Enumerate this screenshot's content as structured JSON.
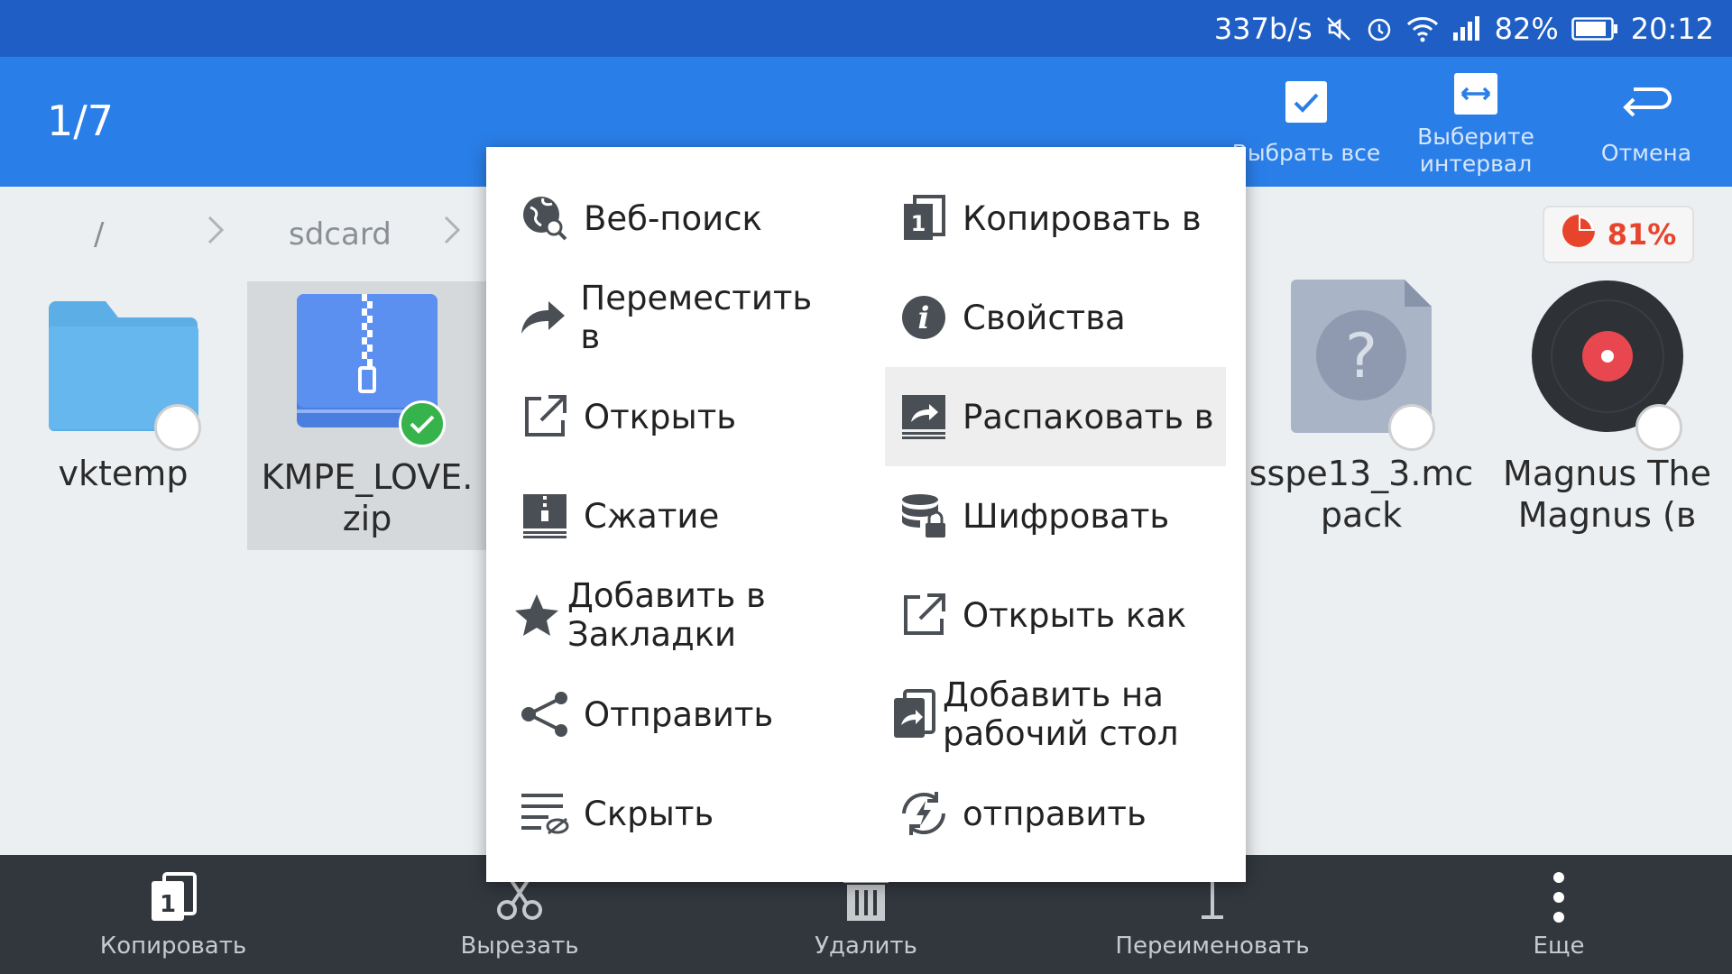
{
  "status_bar": {
    "speed": "337b/s",
    "battery": "82%",
    "time": "20:12"
  },
  "app_bar": {
    "counter": "1/7",
    "actions": [
      {
        "label": "Выбрать все",
        "icon": "select-all-icon"
      },
      {
        "label": "Выберите интервал",
        "icon": "select-range-icon"
      },
      {
        "label": "Отмена",
        "icon": "undo-icon"
      }
    ]
  },
  "breadcrumb": {
    "root": "/",
    "folder": "sdcard"
  },
  "storage": {
    "percent": "81%",
    "color": "#e8442c"
  },
  "files": [
    {
      "name": "vktemp",
      "type": "folder",
      "selected": false
    },
    {
      "name": "KMPE_LOVE.\nzip",
      "type": "zip",
      "selected": true
    },
    {
      "name": "sspe13_3.mc\npack",
      "type": "unknown",
      "selected": false
    },
    {
      "name": "Magnus The\nMagnus (в",
      "type": "audio",
      "selected": false
    }
  ],
  "menu": {
    "left": [
      {
        "label": "Веб-поиск",
        "icon": "web-search-icon"
      },
      {
        "label": "Переместить в",
        "icon": "move-arrow-icon"
      },
      {
        "label": "Открыть",
        "icon": "open-external-icon"
      },
      {
        "label": "Сжатие",
        "icon": "compress-icon"
      },
      {
        "label": "Добавить в Закладки",
        "icon": "star-icon"
      },
      {
        "label": "Отправить",
        "icon": "share-icon"
      },
      {
        "label": "Скрыть",
        "icon": "hide-icon"
      }
    ],
    "right": [
      {
        "label": "Копировать в",
        "icon": "copy-to-icon"
      },
      {
        "label": "Свойства",
        "icon": "info-icon"
      },
      {
        "label": "Распаковать в",
        "icon": "extract-icon",
        "highlighted": true
      },
      {
        "label": "Шифровать",
        "icon": "encrypt-icon"
      },
      {
        "label": "Открыть как",
        "icon": "open-as-icon"
      },
      {
        "label": "Добавить на рабочий стол",
        "icon": "add-desktop-icon"
      },
      {
        "label": "отправить",
        "icon": "send-flash-icon"
      }
    ]
  },
  "bottom_bar": [
    {
      "label": "Копировать",
      "icon": "copy-icon"
    },
    {
      "label": "Вырезать",
      "icon": "scissors-icon"
    },
    {
      "label": "Удалить",
      "icon": "trash-icon"
    },
    {
      "label": "Переименовать",
      "icon": "rename-icon"
    },
    {
      "label": "Еще",
      "icon": "more-vertical-icon"
    }
  ],
  "colors": {
    "status_bar": "#1f5fc5",
    "app_bar": "#2a7ee8",
    "bottom_bar": "#32373e",
    "selected_check": "#36b34a"
  }
}
